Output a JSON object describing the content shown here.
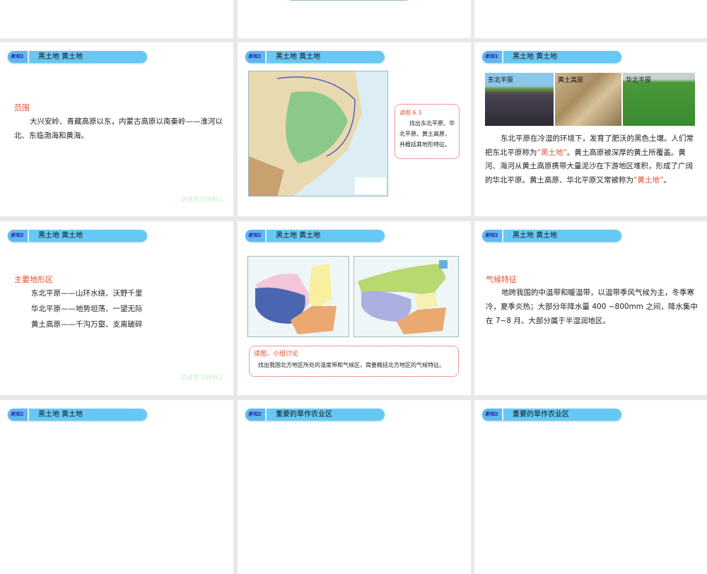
{
  "section1_badge": "新知1",
  "section2_badge": "新知2",
  "section1_title": "黑土地 黄土地",
  "section2_title": "重要的旱作农业区",
  "slides": {
    "range": {
      "heading": "范围",
      "body": "大兴安岭、青藏高原以东，内蒙古高原以南秦岭——淮河以北、东临渤海和黄海。",
      "footer": "达成学习目标1"
    },
    "map63": {
      "callout_title": "读图 6.3",
      "callout_body": "找出东北平原、华北平原、黄土高原，并概括其地形特征。"
    },
    "photos": {
      "labels": [
        "东北平原",
        "黄土高原",
        "华北平原"
      ],
      "body_1": "东北平原在冷湿的环境下，发育了肥沃的黑色土壤。人们常把东北平原称为",
      "hl_1": "“黑土地”",
      "body_2": "。黄土高原被深厚的黄土所覆盖。黄河、海河从黄土高原携带大量泥沙在下游地区堆积，形成了广阔的华北平原。黄土高原、华北平原又常被称为",
      "hl_2": "“黄土地”",
      "body_3": "。"
    },
    "landforms": {
      "heading": "主要地形区",
      "items": [
        "东北平原——山环水绕、沃野千里",
        "华北平原——地势坦荡、一望无际",
        "黄土高原——千沟万壑、支离破碎"
      ],
      "footer": "达成学习目标2"
    },
    "climate_maps": {
      "callout_title": "读图，小组讨论",
      "callout_body": "找出我国北方地区所处的温度带和气候区，简要概括北方地区的气候特征。"
    },
    "climate": {
      "heading": "气候特征",
      "body": "地跨我国的中温带和暖温带，以温带季风气候为主，冬季寒冷，夏季炎热；大部分年降水量 400 ~800mm 之间，降水集中在 7~8 月。大部分属于半湿润地区。"
    }
  },
  "colors": {
    "header": "#66c8f5",
    "accent": "#e05030",
    "footer": "#c8eac8",
    "background": "#e8e8e8"
  }
}
